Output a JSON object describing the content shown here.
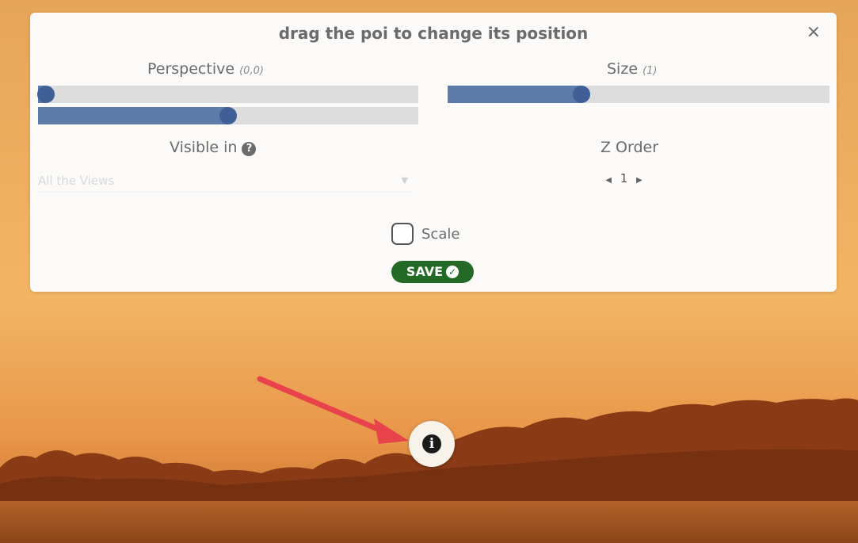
{
  "panel": {
    "title": "drag the poi to change its position",
    "close_icon": "×",
    "perspective": {
      "label": "Perspective",
      "value": "(0,0)",
      "slider1_fraction": 0.02,
      "slider2_fraction": 0.5
    },
    "size": {
      "label": "Size",
      "value": "(1)",
      "slider_fraction": 0.35
    },
    "visible_in": {
      "label": "Visible in",
      "help_icon": "?",
      "selected": "All the Views"
    },
    "z_order": {
      "label": "Z Order",
      "value": "1",
      "prev_icon": "◀",
      "next_icon": "▶"
    },
    "scale": {
      "label": "Scale",
      "checked": false
    },
    "save_label": "SAVE",
    "save_icon": "✓"
  },
  "poi": {
    "icon": "i"
  },
  "colors": {
    "save_green": "#226a25",
    "slider_blue": "#5d7aa9",
    "knob_blue": "#3f5f96",
    "arrow_red": "#e8434b",
    "sky_orange": "#e0a055"
  }
}
